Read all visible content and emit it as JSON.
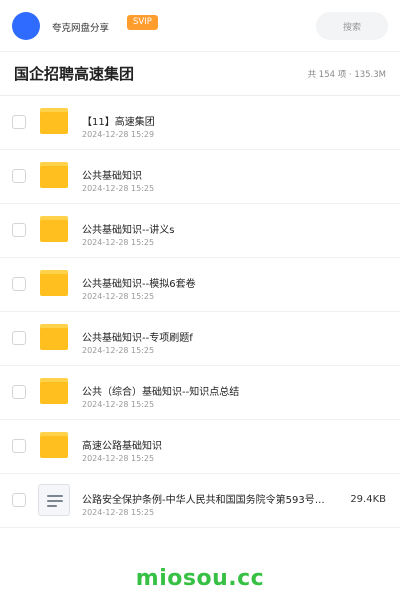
{
  "header": {
    "user_name": "夸克网盘分享",
    "badge": "SVIP",
    "search_label": "搜索"
  },
  "folder": {
    "title": "国企招聘高速集团",
    "stats": "共 154 项 · 135.3M"
  },
  "files": [
    {
      "name": "【11】高速集团",
      "date": "2024-12-28 15:29",
      "type": "folder",
      "size": ""
    },
    {
      "name": "公共基础知识",
      "date": "2024-12-28 15:25",
      "type": "folder",
      "size": ""
    },
    {
      "name": "公共基础知识--讲义s",
      "date": "2024-12-28 15:25",
      "type": "folder",
      "size": ""
    },
    {
      "name": "公共基础知识--模拟6套卷",
      "date": "2024-12-28 15:25",
      "type": "folder",
      "size": ""
    },
    {
      "name": "公共基础知识--专项刷题f",
      "date": "2024-12-28 15:25",
      "type": "folder",
      "size": ""
    },
    {
      "name": "公共（综合）基础知识--知识点总结",
      "date": "2024-12-28 15:25",
      "type": "folder",
      "size": ""
    },
    {
      "name": "高速公路基础知识",
      "date": "2024-12-28 15:25",
      "type": "folder",
      "size": ""
    },
    {
      "name": "公路安全保护条例-中华人民共和国国务院令第593号…",
      "date": "2024-12-28 15:25",
      "type": "doc",
      "size": "29.4KB"
    }
  ],
  "watermark": "miosou.cc",
  "colors": {
    "avatar": "#2f6bff",
    "svip_badge": "#ff9d2f",
    "folder": "#ffc01f",
    "watermark": "#37c144"
  }
}
